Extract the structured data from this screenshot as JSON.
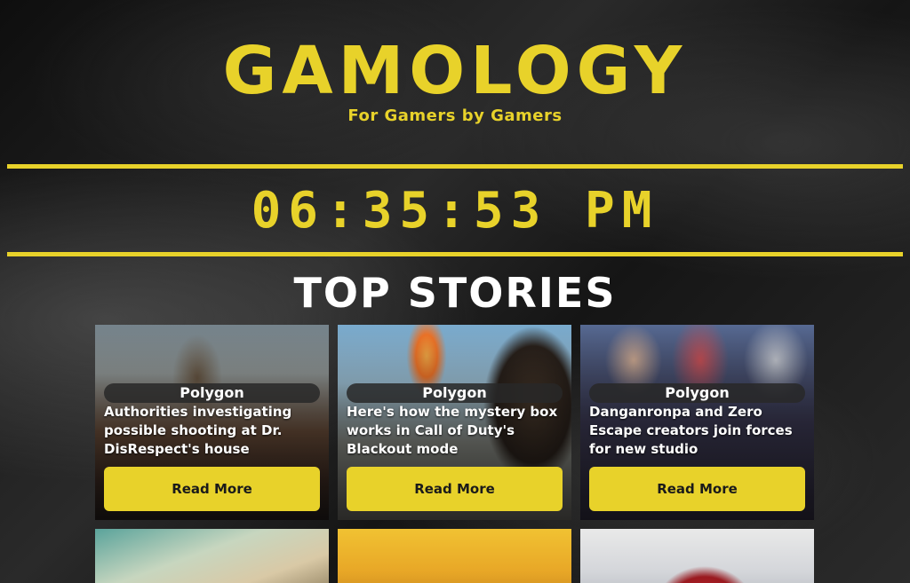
{
  "site": {
    "logo": "GAMOLOGY",
    "tagline": "For Gamers by Gamers"
  },
  "clock": {
    "time": "06:35:53 PM"
  },
  "section": {
    "title": "TOP STORIES"
  },
  "stories": [
    {
      "source": "Polygon",
      "headline": "Authorities investigating possible shooting at Dr. DisRespect's house",
      "button_label": "Read More"
    },
    {
      "source": "Polygon",
      "headline": "Here's how the mystery box works in Call of Duty's Blackout mode",
      "button_label": "Read More"
    },
    {
      "source": "Polygon",
      "headline": "Danganronpa and Zero Escape creators join forces for new studio",
      "button_label": "Read More"
    }
  ],
  "colors": {
    "accent": "#e8d22a",
    "background": "#1a1a1a",
    "text": "#ffffff"
  }
}
